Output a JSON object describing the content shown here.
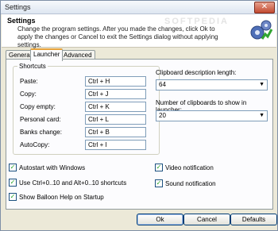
{
  "window": {
    "title": "Settings",
    "close_glyph": "✕"
  },
  "header": {
    "title": "Settings",
    "description": "Change the program settings. After you made the changes, click Ok to apply the changes or Cancel to exit the Settings dialog without applying settings.",
    "watermark": "SOFTPEDIA",
    "icon": "settings-gears-icon"
  },
  "tabs": [
    {
      "label": "General"
    },
    {
      "label": "Launcher"
    },
    {
      "label": "Advanced"
    }
  ],
  "shortcuts": {
    "group_label": "Shortcuts",
    "rows": [
      {
        "label": "Paste:",
        "value": "Ctrl + H"
      },
      {
        "label": "Copy:",
        "value": "Ctrl + J"
      },
      {
        "label": "Copy empty:",
        "value": "Ctrl + K"
      },
      {
        "label": "Personal card:",
        "value": "Ctrl + L"
      },
      {
        "label": "Banks change:",
        "value": "Ctrl + B"
      },
      {
        "label": "AutoCopy:",
        "value": "Ctrl + I"
      }
    ]
  },
  "clipboard": {
    "desc_length_label": "Clipboard description length:",
    "desc_length_value": "64",
    "count_label": "Number of clipboards to show in launcher:",
    "count_value": "20"
  },
  "options": {
    "autostart": {
      "label": "Autostart with Windows",
      "checked": true
    },
    "shortcuts": {
      "label": "Use Ctrl+0..10 and Alt+0..10 shortcuts",
      "checked": true
    },
    "balloon": {
      "label": "Show Balloon Help on Startup",
      "checked": true
    },
    "video": {
      "label": "Video notification",
      "checked": true
    },
    "sound": {
      "label": "Sound notification",
      "checked": true
    },
    "check_glyph": "✓"
  },
  "buttons": {
    "ok": "Ok",
    "cancel": "Cancel",
    "defaults": "Defaults"
  },
  "colors": {
    "accent": "#e8a33c",
    "titlebar": "#dde6f1",
    "dialog": "#ece9d8"
  }
}
